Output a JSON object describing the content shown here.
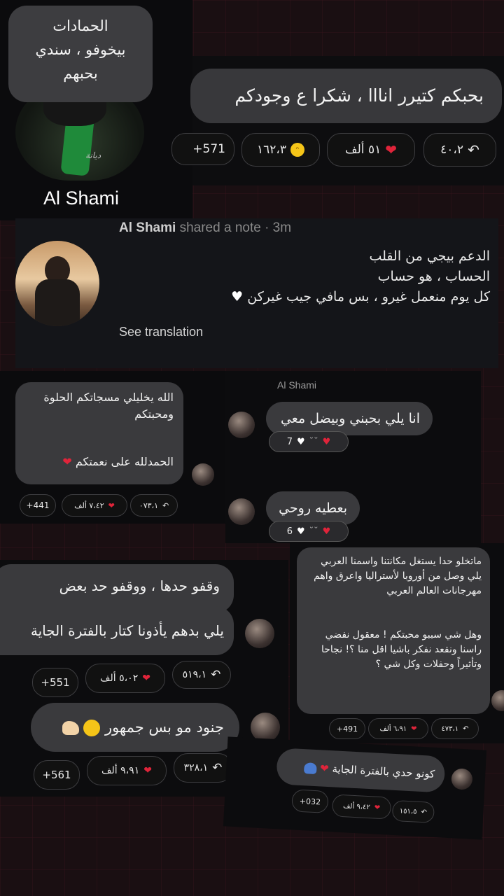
{
  "profile": {
    "bubble_lines": [
      "الحمادات",
      "بيخوفو ، سندي",
      "بحبهم"
    ],
    "name": "Al Shami",
    "watermark": "ديانة"
  },
  "reply_top": {
    "text": "بحبكم كتيرر انااا ، شكرا ع وجودكم",
    "reply_count": "٤٠،٢",
    "likes": "٥١ ألف",
    "laughs": "١٦٢،٣",
    "more": "+571"
  },
  "note": {
    "author": "Al Shami",
    "meta": "shared a note · 3m",
    "lines": [
      "الدعم بيجي من القلب",
      "الحساب ، هو حساب",
      "كل يوم منعمل غيرو ، بس مافي جيب غيركن"
    ],
    "see_translation": "See translation"
  },
  "comment_left1": {
    "line1": "الله يخليلي مسجاتكم الحلوة",
    "line2": "ومحبتكم",
    "line3": "الحمدلله على نعمتكم",
    "reply_count": "٠٧٣،١",
    "likes": "٧،٤٢ ألف",
    "more": "+441"
  },
  "messages": {
    "sender": "Al Shami",
    "msg1": "انا يلي بحبني وبيضل معي",
    "msg1_count": "7",
    "msg2": "بعطيه روحي",
    "msg2_count": "6"
  },
  "comment_left2": {
    "line1": "وقفو حدها ، ووقفو حد بعض",
    "line2": "يلي بدهم يأذونا كتار بالفترة الجاية",
    "reply_count": "٥١٩،١",
    "likes": "٥،٠٢ ألف",
    "more": "+551"
  },
  "comment_left3": {
    "text": "جنود مو بس جمهور",
    "reply_count": "٣٢٨،١",
    "likes": "٩،٩١ ألف",
    "more": "+561"
  },
  "comment_right1": {
    "para1": "ماتخلو حدا يستغل مكانتنا واسمنا العربي يلي وصل من أوروبا لأستراليا واعرق واهم مهرجانات العالم العربي",
    "para2": "وهل شي سببو محبتكم ! معقول نفضي راسنا ونقعد نفكر باشيا اقل منا ؟! نجاحا وتأثيراً وحفلات وكل شي ؟",
    "reply_count": "٤٧٣،١",
    "likes": "٦،٩١ ألف",
    "more": "+491"
  },
  "comment_right2": {
    "text": "كونو حدي بالفترة الجاية",
    "reply_count": "١٥١،٥",
    "likes": "٩،٤٢ ألف",
    "more": "+032"
  },
  "colors": {
    "heart": "#e0243a",
    "bubble": "#3a3a3d",
    "panel": "#0b0b0d"
  }
}
